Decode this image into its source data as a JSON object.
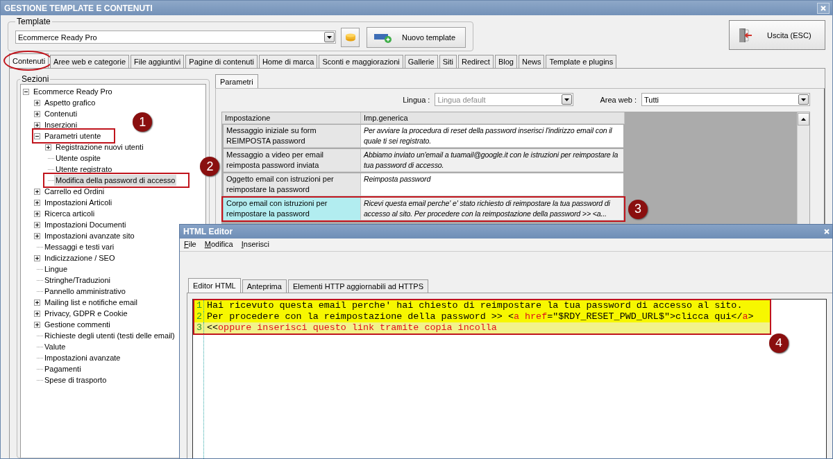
{
  "window": {
    "title": "GESTIONE TEMPLATE E CONTENUTI"
  },
  "template": {
    "label": "Template",
    "value": "Ecommerce Ready Pro",
    "new_button": "Nuovo template"
  },
  "exit_button": "Uscita (ESC)",
  "tabs": [
    {
      "label": "Contenuti",
      "selected": true,
      "circled": true
    },
    {
      "label": "Aree web e categorie",
      "selected": false,
      "circled": false
    },
    {
      "label": "File aggiuntivi",
      "selected": false,
      "circled": false
    },
    {
      "label": "Pagine di contenuti",
      "selected": false,
      "circled": false
    },
    {
      "label": "Home di marca",
      "selected": false,
      "circled": false
    },
    {
      "label": "Sconti e maggiorazioni",
      "selected": false,
      "circled": false
    },
    {
      "label": "Gallerie",
      "selected": false,
      "circled": false
    },
    {
      "label": "Siti",
      "selected": false,
      "circled": false
    },
    {
      "label": "Redirect",
      "selected": false,
      "circled": false
    },
    {
      "label": "Blog",
      "selected": false,
      "circled": false
    },
    {
      "label": "News",
      "selected": false,
      "circled": false
    },
    {
      "label": "Template e plugins",
      "selected": false,
      "circled": false
    }
  ],
  "sections": {
    "label": "Sezioni",
    "tree": [
      {
        "label": "Ecommerce Ready Pro",
        "kind": "expandable",
        "expanded": true,
        "selected": false,
        "highlighted": false,
        "children": [
          {
            "label": "Aspetto grafico",
            "kind": "expandable",
            "expanded": false,
            "selected": false,
            "highlighted": false
          },
          {
            "label": "Contenuti",
            "kind": "expandable",
            "expanded": false,
            "selected": false,
            "highlighted": false
          },
          {
            "label": "Inserzioni",
            "kind": "expandable",
            "expanded": false,
            "selected": false,
            "highlighted": false
          },
          {
            "label": "Parametri utente",
            "kind": "expandable",
            "expanded": true,
            "selected": false,
            "highlighted": true,
            "callout": "1",
            "children": [
              {
                "label": "Registrazione nuovi utenti",
                "kind": "expandable",
                "expanded": false,
                "selected": false,
                "highlighted": false
              },
              {
                "label": "Utente ospite",
                "kind": "leaf",
                "selected": false,
                "highlighted": false
              },
              {
                "label": "Utente registrato",
                "kind": "leaf",
                "selected": false,
                "highlighted": false
              },
              {
                "label": "Modifica della password di accesso",
                "kind": "leaf",
                "selected": true,
                "highlighted": true,
                "callout": "2"
              }
            ]
          },
          {
            "label": "Carrello ed Ordini",
            "kind": "expandable",
            "expanded": false,
            "selected": false,
            "highlighted": false
          },
          {
            "label": "Impostazioni Articoli",
            "kind": "expandable",
            "expanded": false,
            "selected": false,
            "highlighted": false
          },
          {
            "label": "Ricerca articoli",
            "kind": "expandable",
            "expanded": false,
            "selected": false,
            "highlighted": false
          },
          {
            "label": "Impostazioni Documenti",
            "kind": "expandable",
            "expanded": false,
            "selected": false,
            "highlighted": false
          },
          {
            "label": "Impostazioni avanzate sito",
            "kind": "expandable",
            "expanded": false,
            "selected": false,
            "highlighted": false
          },
          {
            "label": "Messaggi e testi vari",
            "kind": "leaf",
            "selected": false,
            "highlighted": false
          },
          {
            "label": "Indicizzazione / SEO",
            "kind": "expandable",
            "expanded": false,
            "selected": false,
            "highlighted": false
          },
          {
            "label": "Lingue",
            "kind": "leaf",
            "selected": false,
            "highlighted": false
          },
          {
            "label": "Stringhe/Traduzioni",
            "kind": "leaf",
            "selected": false,
            "highlighted": false
          },
          {
            "label": "Pannello amministrativo",
            "kind": "leaf",
            "selected": false,
            "highlighted": false
          },
          {
            "label": "Mailing list e notifiche email",
            "kind": "expandable",
            "expanded": false,
            "selected": false,
            "highlighted": false
          },
          {
            "label": "Privacy, GDPR e Cookie",
            "kind": "expandable",
            "expanded": false,
            "selected": false,
            "highlighted": false
          },
          {
            "label": "Gestione commenti",
            "kind": "expandable",
            "expanded": false,
            "selected": false,
            "highlighted": false
          },
          {
            "label": "Richieste degli utenti (testi delle email)",
            "kind": "leaf",
            "selected": false,
            "highlighted": false
          },
          {
            "label": "Valute",
            "kind": "leaf",
            "selected": false,
            "highlighted": false
          },
          {
            "label": "Impostazioni avanzate",
            "kind": "leaf",
            "selected": false,
            "highlighted": false
          },
          {
            "label": "Pagamenti",
            "kind": "leaf",
            "selected": false,
            "highlighted": false
          },
          {
            "label": "Spese di trasporto",
            "kind": "leaf",
            "selected": false,
            "highlighted": false
          }
        ]
      }
    ]
  },
  "parameters": {
    "tab": {
      "label": "Parametri",
      "selected": true
    },
    "language": {
      "label": "Lingua :",
      "value": "Lingua default",
      "disabled": true
    },
    "area": {
      "label": "Area web :",
      "value": "Tutti",
      "disabled": false
    },
    "table": {
      "columns": [
        "Impostazione",
        "Imp.generica"
      ],
      "rows": [
        {
          "setting": "Messaggio iniziale su form REIMPOSTA password",
          "value": "Per avviare la procedura di reset della password inserisci l'indirizzo email con il quale ti sei registrato.",
          "selected": false,
          "highlighted": false
        },
        {
          "setting": "Messaggio a video per email reimposta password inviata",
          "value": "Abbiamo inviato un'email a tuamail@google.it con le istruzioni per reimpostare la tua password di accesso.",
          "selected": false,
          "highlighted": false
        },
        {
          "setting": "Oggetto email con istruzioni per reimpostare la password",
          "value": "Reimposta password",
          "selected": false,
          "highlighted": false
        },
        {
          "setting": "Corpo email con istruzioni per reimpostare la password",
          "value": "Ricevi questa email perche' e' stato richiesto di reimpostare la tua password di accesso al sito. Per procedere con la reimpostazione della password >> <a...",
          "selected": true,
          "highlighted": true,
          "callout": "3"
        }
      ]
    }
  },
  "html_editor": {
    "title": "HTML Editor",
    "menu": [
      "File",
      "Modifica",
      "Inserisci"
    ],
    "tabs": [
      {
        "label": "Editor HTML",
        "selected": true
      },
      {
        "label": "Anteprima",
        "selected": false
      },
      {
        "label": "Elementi HTTP aggiornabili ad HTTPS",
        "selected": false
      }
    ],
    "code": {
      "highlighted": true,
      "callout": "4",
      "lines": [
        {
          "number": "1",
          "current": false,
          "tokens": [
            {
              "kind": "plain",
              "text": "Hai ricevuto questa email perche' hai chiesto di reimpostare la tua password di accesso al sito."
            }
          ]
        },
        {
          "number": "2",
          "current": false,
          "tokens": [
            {
              "kind": "plain",
              "text": "Per procedere con la reimpostazione della password >> <"
            },
            {
              "kind": "keyword",
              "text": "a href"
            },
            {
              "kind": "plain",
              "text": "=\"$RDY_RESET_PWD_URL$\">clicca qui</"
            },
            {
              "kind": "keyword",
              "text": "a"
            },
            {
              "kind": "plain",
              "text": ">"
            }
          ]
        },
        {
          "number": "3",
          "current": true,
          "tokens": [
            {
              "kind": "plain",
              "text": "<<"
            },
            {
              "kind": "keyword",
              "text": "oppure inserisci questo link tramite copia incolla"
            }
          ]
        }
      ]
    }
  }
}
